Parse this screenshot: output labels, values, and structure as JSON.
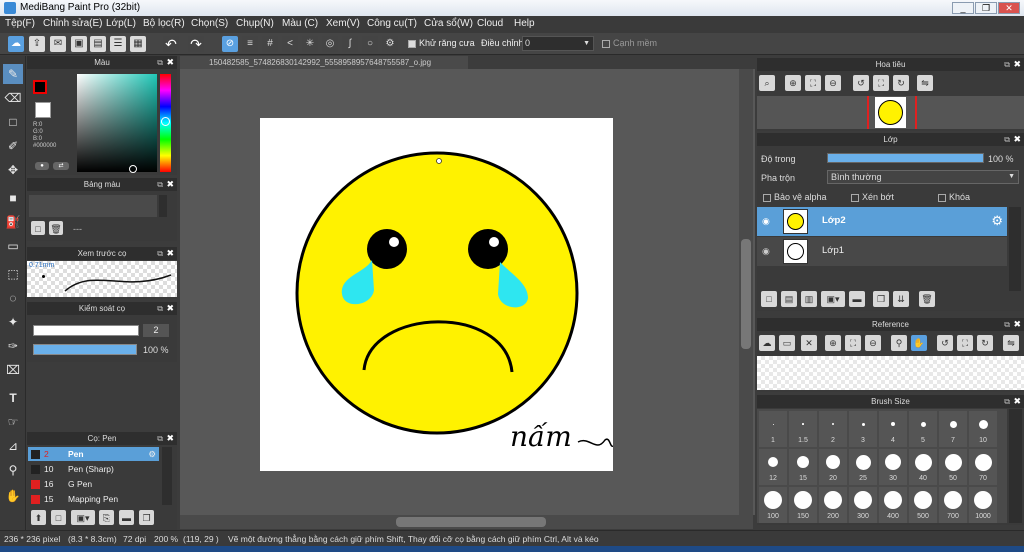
{
  "window": {
    "title": "MediBang Paint Pro (32bit)",
    "min": "_",
    "max": "❐",
    "close": "✕"
  },
  "menu": [
    "Tệp(F)",
    "Chỉnh sửa(E)",
    "Lớp(L)",
    "Bộ lọc(R)",
    "Chọn(S)",
    "Chụp(N)",
    "Màu (C)",
    "Xem(V)",
    "Công cụ(T)",
    "Cửa sổ(W)",
    "Cloud",
    "Help"
  ],
  "toolbar": {
    "antialias_label": "Khử răng cưa",
    "adjust_label": "Điều chỉnh",
    "adjust_value": "0",
    "sharp_label": "Cạnh mềm"
  },
  "color_panel": {
    "title": "Màu",
    "r": "R:0",
    "g": "G:0",
    "b": "B:0",
    "hex": "#000000",
    "fg": "#000000",
    "bg": "#ffffff"
  },
  "palette_panel": {
    "title": "Bảng màu",
    "dash": "---"
  },
  "brush_preview_panel": {
    "title": "Xem trước cọ",
    "size": "0.71mm"
  },
  "brush_control_panel": {
    "title": "Kiểm soát cọ",
    "size_value": "2",
    "opacity_value": "100 %",
    "opacity": 1.0
  },
  "pen_panel": {
    "title": "Cọ: Pen",
    "items": [
      {
        "size": "2",
        "name": "Pen",
        "color": "#222222",
        "selected": true
      },
      {
        "size": "10",
        "name": "Pen (Sharp)",
        "color": "#222222",
        "selected": false
      },
      {
        "size": "16",
        "name": "G Pen",
        "color": "#e02020",
        "selected": false
      },
      {
        "size": "15",
        "name": "Mapping Pen",
        "color": "#e02020",
        "selected": false
      }
    ]
  },
  "document": {
    "tab": "150482585_574826830142992_5558958957648755587_o.jpg",
    "handwriting": "nấm"
  },
  "navigator_panel": {
    "title": "Hoa tiêu"
  },
  "layer_panel": {
    "title": "Lớp",
    "opacity_label": "Độ trong",
    "opacity_value": "100 %",
    "opacity": 1.0,
    "blend_label": "Pha trộn",
    "blend_value": "Bình thường",
    "protect_alpha": "Bảo vệ alpha",
    "clipping": "Xén bớt",
    "lock": "Khóa",
    "layers": [
      {
        "name": "Lớp2",
        "selected": true
      },
      {
        "name": "Lớp1",
        "selected": false
      }
    ]
  },
  "reference_panel": {
    "title": "Reference"
  },
  "brush_size_panel": {
    "title": "Brush Size",
    "sizes": [
      "1",
      "1.5",
      "2",
      "3",
      "4",
      "5",
      "7",
      "10",
      "12",
      "15",
      "20",
      "25",
      "30",
      "40",
      "50",
      "70",
      "100",
      "150",
      "200",
      "300",
      "400",
      "500",
      "700",
      "1000"
    ]
  },
  "statusbar": {
    "size": "236 * 236 pixel",
    "dimensions": "(8.3 * 8.3cm)",
    "dpi": "72 dpi",
    "zoom": "200 %",
    "coords": "(119, 29 )",
    "hint": "Vẽ một đường thẳng bằng cách giữ phím Shift, Thay đổi cỡ cọ bằng cách giữ phím Ctrl, Alt và kéo"
  },
  "colors": {
    "face": "#fff200",
    "tear": "#2ee6f0",
    "accent": "#5aa0e0"
  }
}
